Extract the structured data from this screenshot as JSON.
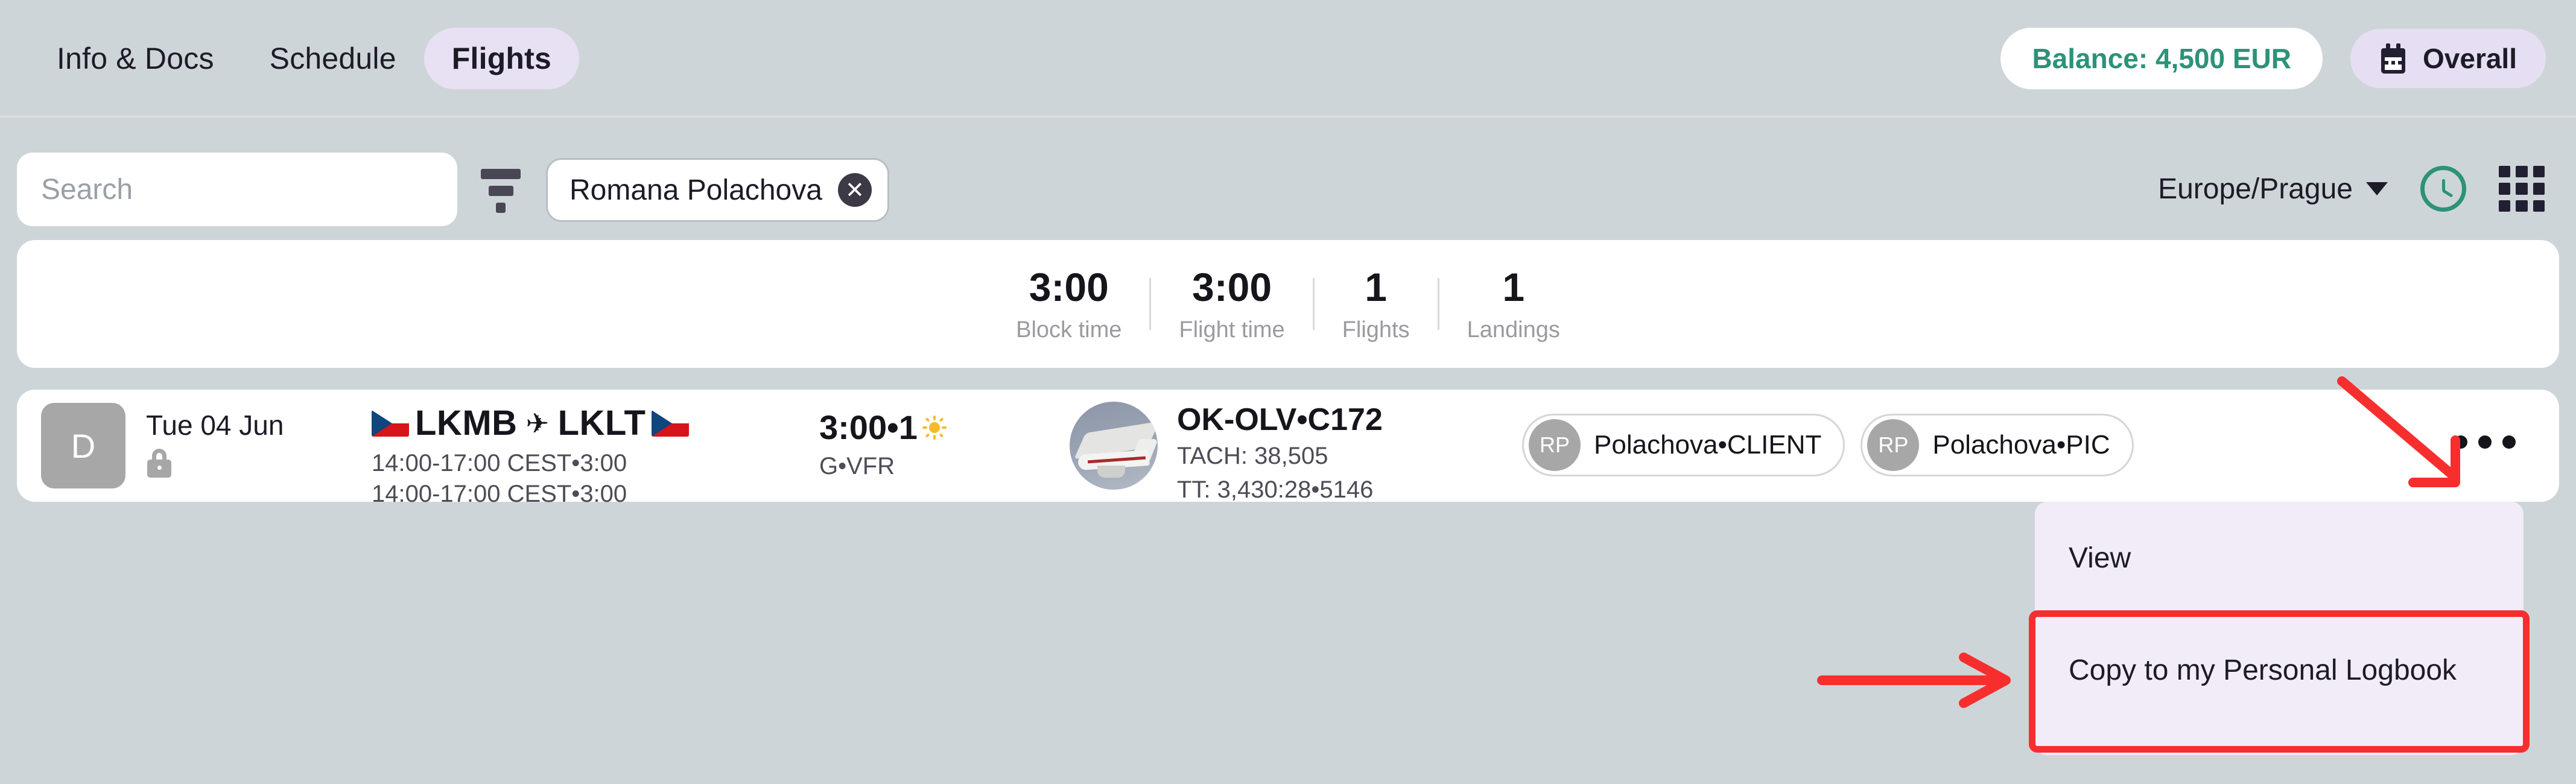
{
  "nav": {
    "tabs": [
      {
        "label": "Info & Docs",
        "active": false
      },
      {
        "label": "Schedule",
        "active": false
      },
      {
        "label": "Flights",
        "active": true
      }
    ],
    "balance_label": "Balance: 4,500 EUR",
    "overall_label": "Overall",
    "calendar_icon": "calendar-icon",
    "balance_color": "#2d9279",
    "active_tab_bg": "#e8e0f3"
  },
  "filterbar": {
    "search_placeholder": "Search",
    "search_value": "",
    "filter_icon": "filter-icon",
    "chip": {
      "label": "Romana Polachova",
      "clear_icon": "clear-circle-icon"
    },
    "timezone": "Europe/Prague",
    "timezone_caret": "chevron-down-icon",
    "clock_icon": "clock-icon",
    "grid_icon": "grid-apps-icon",
    "clock_color": "#2d9279"
  },
  "stats": [
    {
      "value": "3:00",
      "label": "Block time"
    },
    {
      "value": "3:00",
      "label": "Flight time"
    },
    {
      "value": "1",
      "label": "Flights"
    },
    {
      "value": "1",
      "label": "Landings"
    }
  ],
  "flight": {
    "badge": "D",
    "lock_icon": "lock-icon",
    "date": "Tue 04 Jun",
    "departure_flag": "cz-flag-icon",
    "arrival_flag": "cz-flag-icon",
    "from": "LKMB",
    "plane_glyph": "✈",
    "to": "LKLT",
    "time_line_1": "14:00-17:00 CEST•3:00",
    "time_line_2": "14:00-17:00 CEST•3:00",
    "duration": "3:00•1",
    "sun_icon": "sun-icon",
    "rules": "G•VFR",
    "aircraft_photo": "aircraft-photo",
    "aircraft_title": "OK-OLV•C172",
    "tach": "TACH: 38,505",
    "tt": "TT: 3,430:28•5146",
    "crew": [
      {
        "initials": "RP",
        "name": "Polachova•CLIENT"
      },
      {
        "initials": "RP",
        "name": "Polachova•PIC"
      }
    ],
    "more_icon": "more-options-icon"
  },
  "context_menu": {
    "items": [
      {
        "label": "View",
        "highlighted": false
      },
      {
        "label": "Copy to my Personal Logbook",
        "highlighted": true
      }
    ],
    "background": "#f1ecf7",
    "highlight_color": "#f72e2e"
  },
  "annotations": {
    "arrow_color": "#f72e2e",
    "arrow_to_more": "arrow-pointing-to-more-options",
    "arrow_to_copy": "arrow-pointing-to-copy-item"
  }
}
